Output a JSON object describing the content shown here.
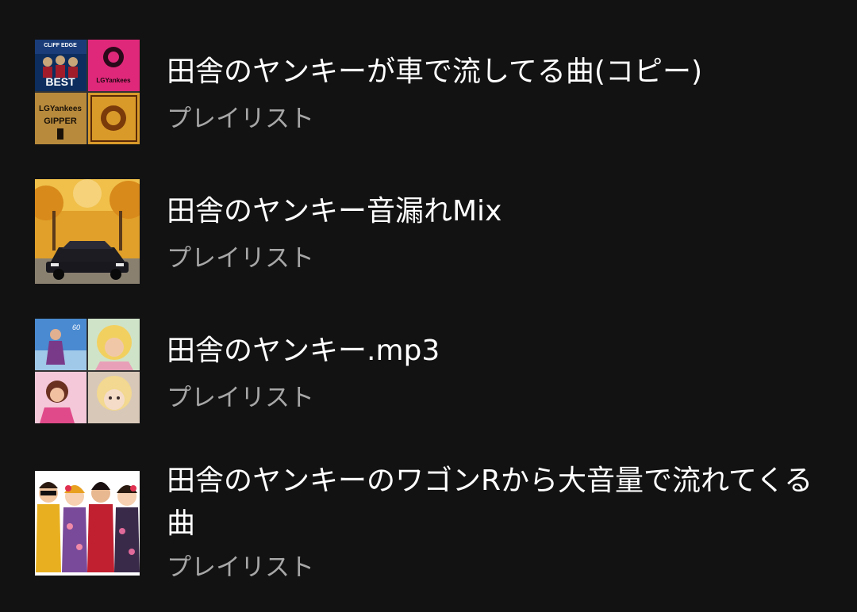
{
  "playlists": [
    {
      "title": "田舎のヤンキーが車で流してる曲(コピー)",
      "subtitle": "プレイリスト",
      "cover": "four-album-collage-cover"
    },
    {
      "title": "田舎のヤンキー音漏れMix",
      "subtitle": "プレイリスト",
      "cover": "car-autumn-trees-cover"
    },
    {
      "title": "田舎のヤンキー.mp3",
      "subtitle": "プレイリスト",
      "cover": "four-portrait-collage-cover"
    },
    {
      "title": "田舎のヤンキーのワゴンRから大音量で流れてくる曲",
      "subtitle": "プレイリスト",
      "cover": "illustrated-people-cover"
    }
  ],
  "colors": {
    "background": "#121212",
    "title": "#ffffff",
    "subtitle": "#a7a7a7"
  },
  "cover_text": {
    "p1_top_left_small": "CLIFF EDGE",
    "p1_top_left_big": "BEST",
    "p1_top_right": "LGYankees",
    "p1_bottom_left_top": "LGYankees",
    "p1_bottom_left_bottom": "GIPPER"
  }
}
